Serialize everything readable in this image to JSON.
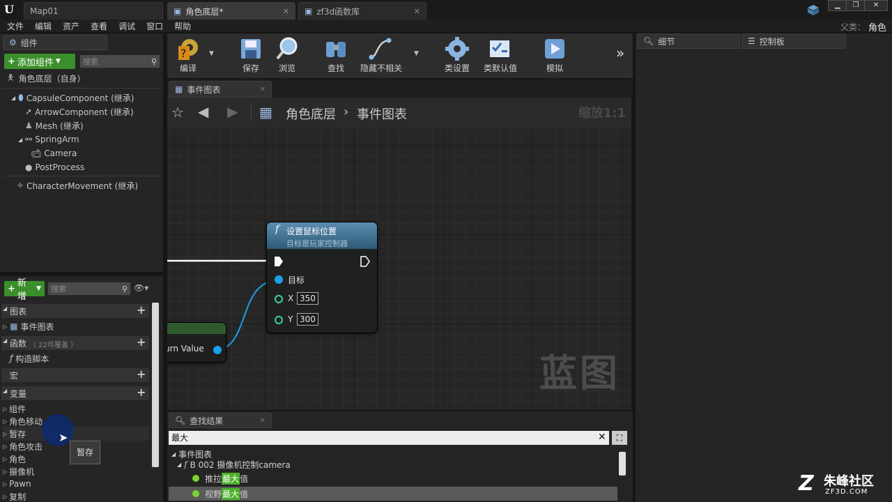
{
  "tabs": [
    {
      "label": "Map01"
    },
    {
      "label": "角色底层*"
    },
    {
      "label": "zf3d函数库"
    }
  ],
  "top_right": {
    "parent_label": "父类：",
    "parent_value": "角色"
  },
  "menu": [
    "文件",
    "编辑",
    "资产",
    "查看",
    "调试",
    "窗口",
    "帮助"
  ],
  "components_panel": {
    "tab": "组件",
    "add_button": "添加组件",
    "search_placeholder": "搜索",
    "root": "角色底层（自身）",
    "items": [
      {
        "label": "CapsuleComponent (继承)"
      },
      {
        "label": "ArrowComponent (继承)"
      },
      {
        "label": "Mesh (继承)"
      },
      {
        "label": "SpringArm"
      },
      {
        "label": "Camera"
      },
      {
        "label": "PostProcess"
      },
      {
        "label": "CharacterMovement (继承)"
      }
    ]
  },
  "myblueprint_panel": {
    "new_button": "新增",
    "search_placeholder": "搜索",
    "sections": {
      "graphs": "图表",
      "event_graph": "事件图表",
      "functions": "函数",
      "functions_note": "（ 22可覆盖 ）",
      "construction_script": "构造脚本",
      "macros": "宏",
      "variables": "变量"
    },
    "variable_categories": [
      "组件",
      "角色移动",
      "暂存",
      "角色攻击",
      "角色",
      "摄像机",
      "Pawn",
      "复制"
    ],
    "tooltip": "暂存"
  },
  "toolbar": {
    "compile": "编译",
    "save": "保存",
    "browse": "浏览",
    "find": "查找",
    "hide_unrelated": "隐藏不相关",
    "class_settings": "类设置",
    "class_defaults": "类默认值",
    "simulate": "模拟"
  },
  "graph_tab": "事件图表",
  "breadcrumb": {
    "root": "角色底层",
    "current": "事件图表"
  },
  "zoom_label": "缩放1:1",
  "watermark": "蓝图",
  "node": {
    "title": "设置鼠标位置",
    "subtitle": "目标是玩家控制器",
    "target_label": "目标",
    "x_label": "X",
    "x_value": "350",
    "y_label": "Y",
    "y_value": "300"
  },
  "left_node": {
    "output_label": "urn Value"
  },
  "find_results": {
    "tab": "查找结果",
    "query": "最大",
    "root": "事件图表",
    "function": "B 002 摄像机控制camera",
    "results": [
      {
        "pre": "推拉",
        "match": "最大",
        "post": "值"
      },
      {
        "pre": "视野",
        "match": "最大",
        "post": "值"
      }
    ]
  },
  "details_tab": "细节",
  "dashboard_tab": "控制板",
  "site_logo": {
    "name": "朱峰社区",
    "url": "ZF3D.COM"
  },
  "colors": {
    "accent_green": "#3a8f2a",
    "node_header": "#3d6b8a",
    "exec_wire": "#ffffff",
    "object_pin": "#1aa0e8",
    "float_pin": "#3bd3a0",
    "highlight": "#4bb02a"
  }
}
